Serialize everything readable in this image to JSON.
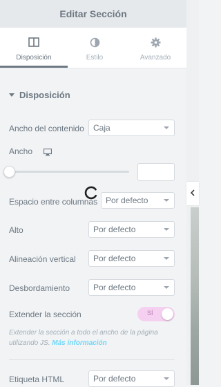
{
  "header": {
    "title": "Editar Sección"
  },
  "tabs": [
    {
      "label": "Disposición",
      "icon": "layout-icon",
      "active": true
    },
    {
      "label": "Estilo",
      "icon": "half-circle-icon",
      "active": false
    },
    {
      "label": "Avanzado",
      "icon": "gear-icon",
      "active": false
    }
  ],
  "section": {
    "title": "Disposición"
  },
  "fields": {
    "content_width": {
      "label": "Ancho del contenido",
      "value": "Caja"
    },
    "width": {
      "label": "Ancho",
      "value": ""
    },
    "column_gap": {
      "label": "Espacio entre columnas",
      "value": "Por defecto"
    },
    "height": {
      "label": "Alto",
      "value": "Por defecto"
    },
    "vertical_align": {
      "label": "Alineación vertical",
      "value": "Por defecto"
    },
    "overflow": {
      "label": "Desbordamiento",
      "value": "Por defecto"
    },
    "stretch": {
      "label": "Extender la sección",
      "toggle_label": "SÍ",
      "on": true
    },
    "html_tag": {
      "label": "Etiqueta HTML",
      "value": "Por defecto"
    }
  },
  "description": {
    "text": "Extender la sección a todo el ancho de la página utilizando JS.",
    "link": "Más información"
  },
  "colors": {
    "accent": "#71d7f7",
    "toggle_bg": "#f5d0f0",
    "text": "#6d7882"
  }
}
